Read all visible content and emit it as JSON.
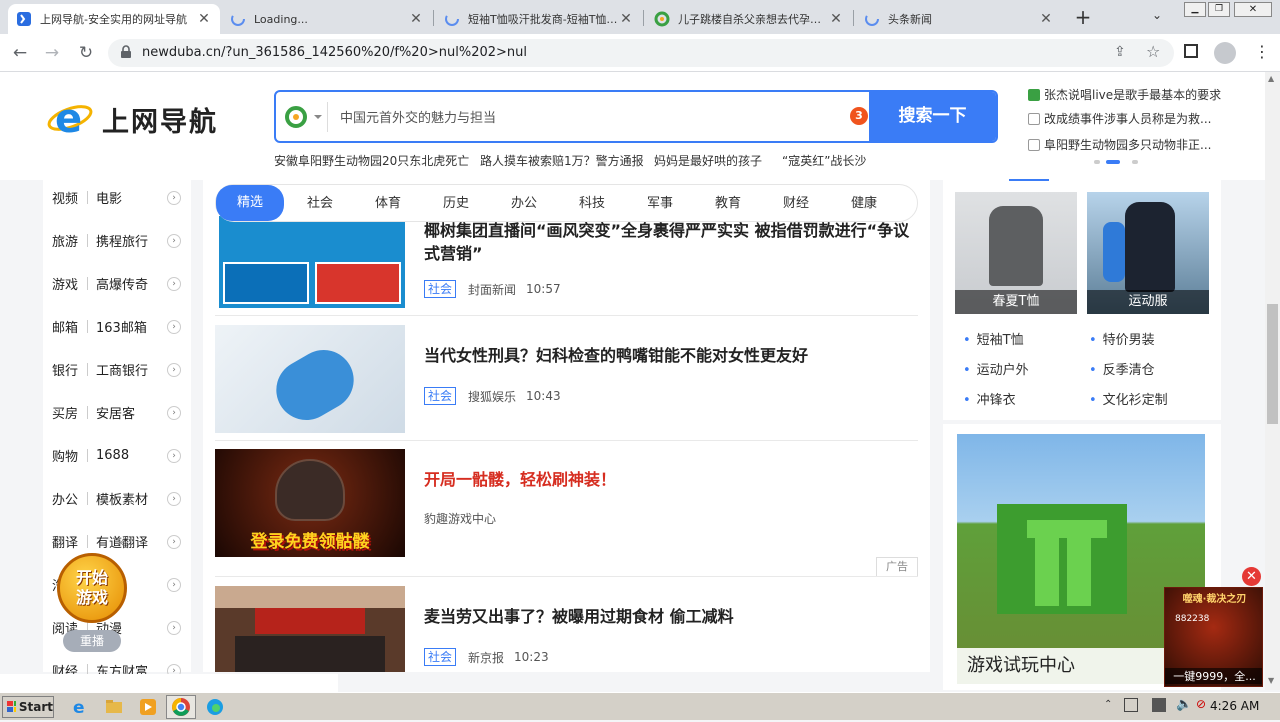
{
  "browser": {
    "tabs": [
      {
        "title": "上网导航-安全实用的网址导航",
        "active": true
      },
      {
        "title": "Loading...",
        "active": false
      },
      {
        "title": "短袖T恤吸汗批发商-短袖T恤吸汗...",
        "active": false
      },
      {
        "title": "儿子跳楼自杀父亲想去代孕被...",
        "active": false
      },
      {
        "title": "头条新闻",
        "active": false
      }
    ],
    "url": "newduba.cn/?un_361586_142560%20/f%20>nul%202>nul"
  },
  "header": {
    "logo": "上网导航",
    "search_placeholder": "中国元首外交的魅力与担当",
    "search_badge": "3",
    "search_button": "搜索一下",
    "hot_links": [
      "安徽阜阳野生动物园20只东北虎死亡",
      "路人摸车被索赔1万？警方通报",
      "妈妈是最好哄的孩子",
      "“寇英红”战长沙"
    ],
    "right_news": [
      "张杰说唱live是歌手最基本的要求",
      "改成绩事件涉事人员称是为救...",
      "阜阳野生动物园多只动物非正..."
    ]
  },
  "leftnav": [
    {
      "a": "视频",
      "b": "电影"
    },
    {
      "a": "旅游",
      "b": "携程旅行"
    },
    {
      "a": "游戏",
      "b": "高爆传奇"
    },
    {
      "a": "邮箱",
      "b": "163邮箱"
    },
    {
      "a": "银行",
      "b": "工商银行"
    },
    {
      "a": "买房",
      "b": "安居客"
    },
    {
      "a": "购物",
      "b": "1688"
    },
    {
      "a": "办公",
      "b": "模板素材"
    },
    {
      "a": "翻译",
      "b": "有道翻译"
    },
    {
      "a": "汽车",
      "b": "汽车"
    },
    {
      "a": "阅读",
      "b": "动漫"
    },
    {
      "a": "财经",
      "b": "东方财富"
    }
  ],
  "floating_game": {
    "label1": "开始",
    "label2": "游戏",
    "replay": "重播",
    "close": "×"
  },
  "feed": {
    "tabs": [
      "精选",
      "社会",
      "体育",
      "历史",
      "办公",
      "科技",
      "军事",
      "教育",
      "财经",
      "健康"
    ],
    "items": [
      {
        "title": "椰树集团直播间“画风突变”全身裹得严严实实 被指借罚款进行“争议式营销”",
        "tag": "社会",
        "source": "封面新闻",
        "time": "10:57"
      },
      {
        "title": "当代女性刑具？妇科检查的鸭嘴钳能不能对女性更友好",
        "tag": "社会",
        "source": "搜狐娱乐",
        "time": "10:43"
      },
      {
        "title": "开局一骷髅，轻松刷神装！",
        "source": "豹趣游戏中心",
        "ad_label": "广告",
        "ad_banner": "登录免费领骷髅"
      },
      {
        "title": "麦当劳又出事了？被曝用过期食材 偷工减料",
        "tag": "社会",
        "source": "新京报",
        "time": "10:23"
      }
    ]
  },
  "right": {
    "products": [
      {
        "caption": "春夏T恤"
      },
      {
        "caption": "运动服"
      }
    ],
    "links": [
      "短袖T恤",
      "特价男装",
      "运动户外",
      "反季清仓",
      "冲锋衣",
      "文化衫定制"
    ],
    "game_center": "游戏试玩中心",
    "popup_ad": {
      "title": "噬魂·裁决之刃",
      "num": "882238",
      "caption": "一键9999，全..."
    }
  },
  "taskbar": {
    "start": "Start",
    "time": "4:26 AM"
  },
  "colors": {
    "accent": "#3a7cf6",
    "ad_red": "#d62d20"
  }
}
